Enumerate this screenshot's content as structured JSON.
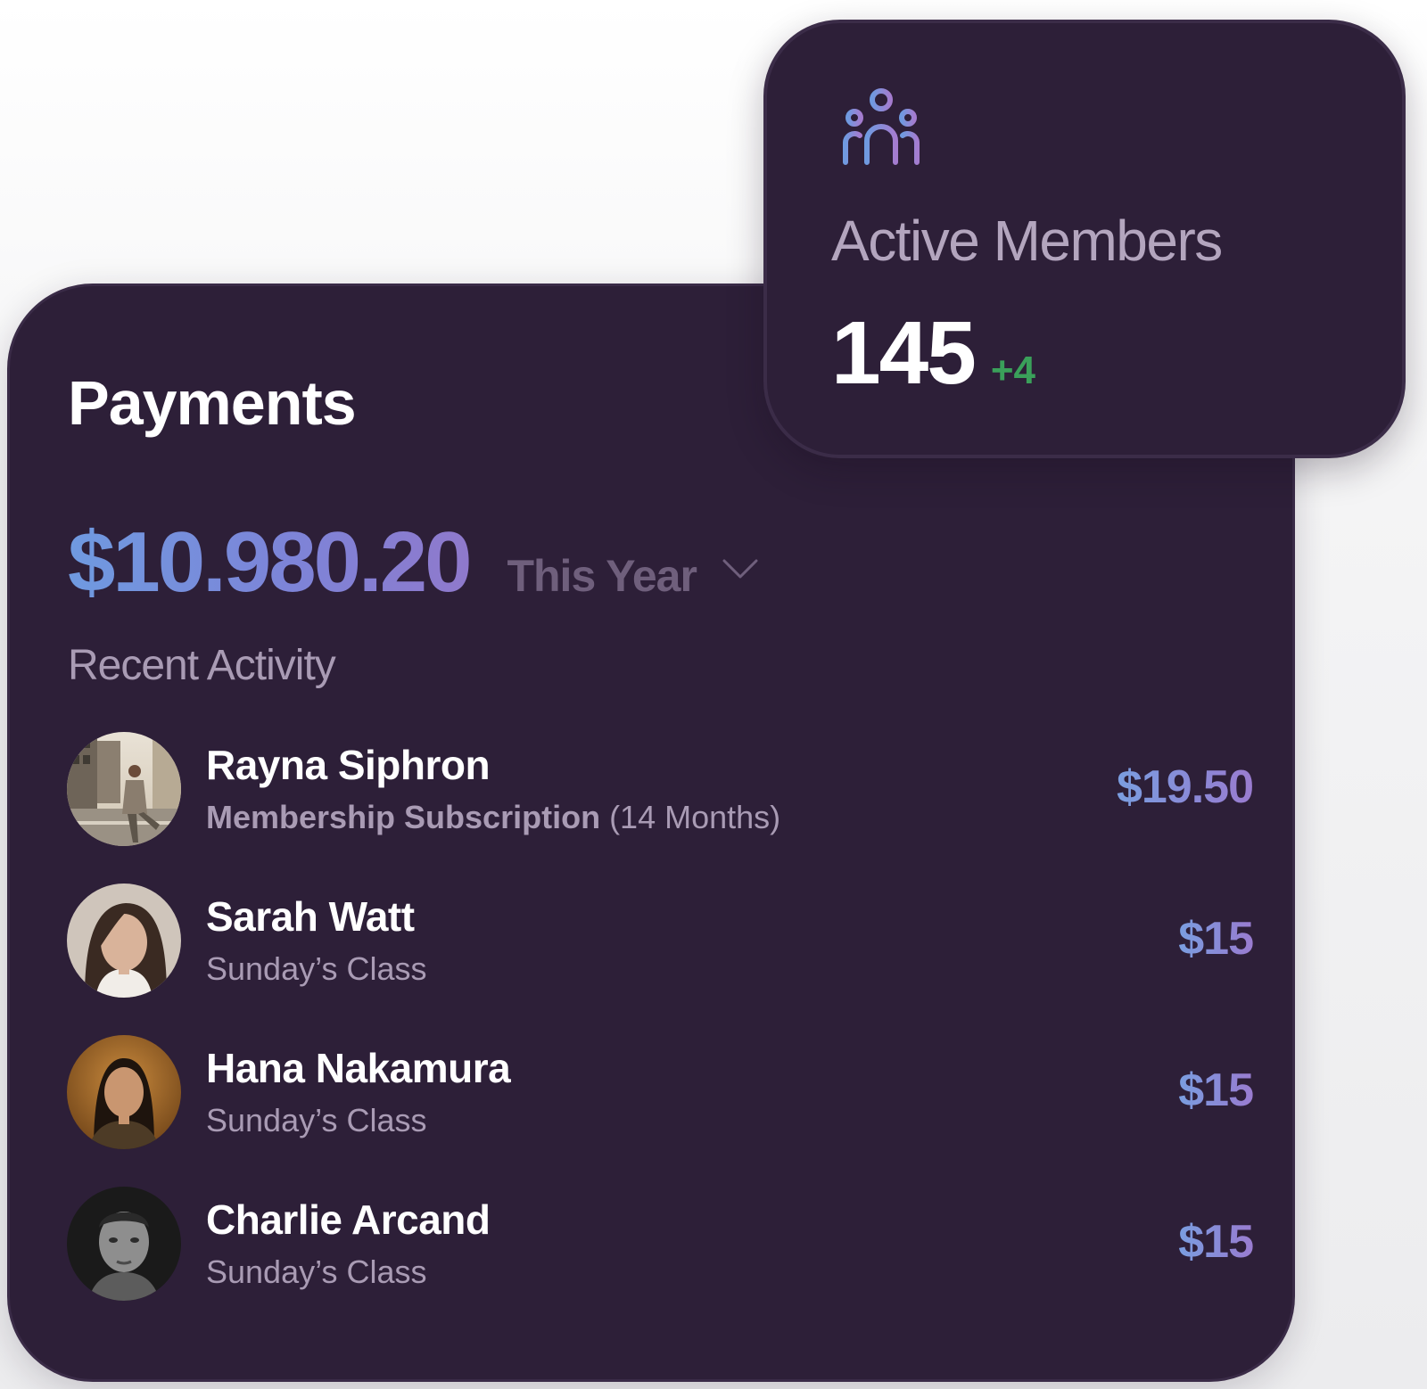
{
  "payments": {
    "title": "Payments",
    "total": "$10.980.20",
    "period": "This Year",
    "section_label": "Recent Activity",
    "activity": [
      {
        "name": "Rayna Siphron",
        "description": "Membership Subscription",
        "detail": "(14 Months)",
        "amount": "$19.50",
        "avatar": "street-photo-avatar"
      },
      {
        "name": "Sarah Watt",
        "description": "Sunday’s Class",
        "detail": "",
        "amount": "$15",
        "avatar": "portrait-avatar"
      },
      {
        "name": "Hana Nakamura",
        "description": "Sunday’s Class",
        "detail": "",
        "amount": "$15",
        "avatar": "portrait-avatar"
      },
      {
        "name": "Charlie Arcand",
        "description": "Sunday’s Class",
        "detail": "",
        "amount": "$15",
        "avatar": "portrait-avatar"
      }
    ]
  },
  "members": {
    "icon": "members-icon",
    "title": "Active Members",
    "count": "145",
    "delta": "+4"
  },
  "colors": {
    "card_bg": "#2d1f38",
    "accent_blue": "#6f9ae0",
    "accent_purple": "#9a7cd0",
    "positive": "#3aa05a",
    "muted_text": "#a99bb4"
  }
}
